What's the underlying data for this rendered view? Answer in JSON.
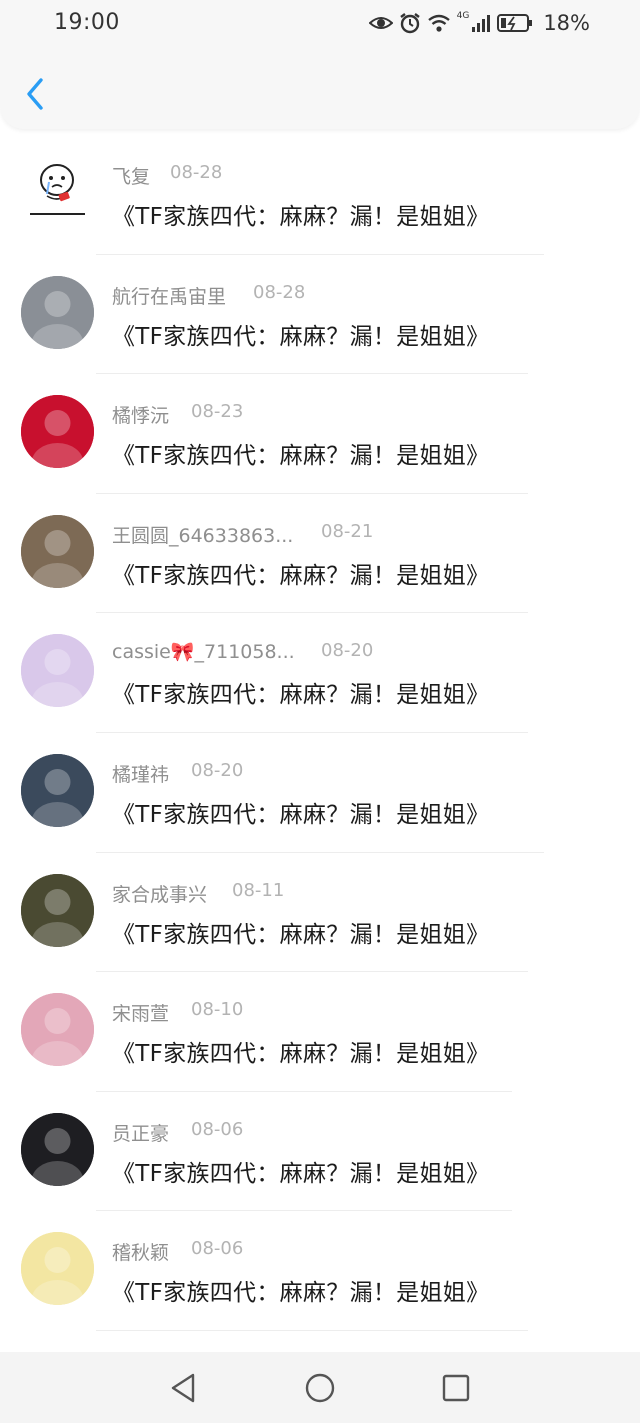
{
  "status_bar": {
    "time": "19:00",
    "network": "4G",
    "battery_percent": "18%",
    "icons": [
      "eye-comfort-icon",
      "alarm-icon",
      "wifi-icon",
      "signal-icon",
      "battery-icon"
    ]
  },
  "nav": {
    "back_icon": "chevron-left-icon"
  },
  "messages": [
    {
      "name": "飞复",
      "date": "08-28",
      "title": "《TF家族四代：麻麻？漏！是姐姐》",
      "avatar_color": "#ffffff"
    },
    {
      "name": "航行在禹宙里",
      "date": "08-28",
      "title": "《TF家族四代：麻麻？漏！是姐姐》",
      "avatar_color": "#8a8f96"
    },
    {
      "name": "橘悸沅",
      "date": "08-23",
      "title": "《TF家族四代：麻麻？漏！是姐姐》",
      "avatar_color": "#c8102e"
    },
    {
      "name": "王圆圆_64633863...",
      "date": "08-21",
      "title": "《TF家族四代：麻麻？漏！是姐姐》",
      "avatar_color": "#7d6a55"
    },
    {
      "name": "cassie🎀_711058...",
      "date": "08-20",
      "title": "《TF家族四代：麻麻？漏！是姐姐》",
      "avatar_color": "#d9c8ea"
    },
    {
      "name": "橘瑾祎",
      "date": "08-20",
      "title": "《TF家族四代：麻麻？漏！是姐姐》",
      "avatar_color": "#3b4a5c"
    },
    {
      "name": "家合成事兴",
      "date": "08-11",
      "title": "《TF家族四代：麻麻？漏！是姐姐》",
      "avatar_color": "#4a4a32"
    },
    {
      "name": "宋雨萱",
      "date": "08-10",
      "title": "《TF家族四代：麻麻？漏！是姐姐》",
      "avatar_color": "#e3a7b8"
    },
    {
      "name": "员正豪",
      "date": "08-06",
      "title": "《TF家族四代：麻麻？漏！是姐姐》",
      "avatar_color": "#1e1e22"
    },
    {
      "name": "稽秋颖",
      "date": "08-06",
      "title": "《TF家族四代：麻麻？漏！是姐姐》",
      "avatar_color": "#f3e6a2"
    }
  ],
  "system_nav": {
    "back_icon": "triangle-back-icon",
    "home_icon": "circle-home-icon",
    "recents_icon": "square-recents-icon"
  }
}
